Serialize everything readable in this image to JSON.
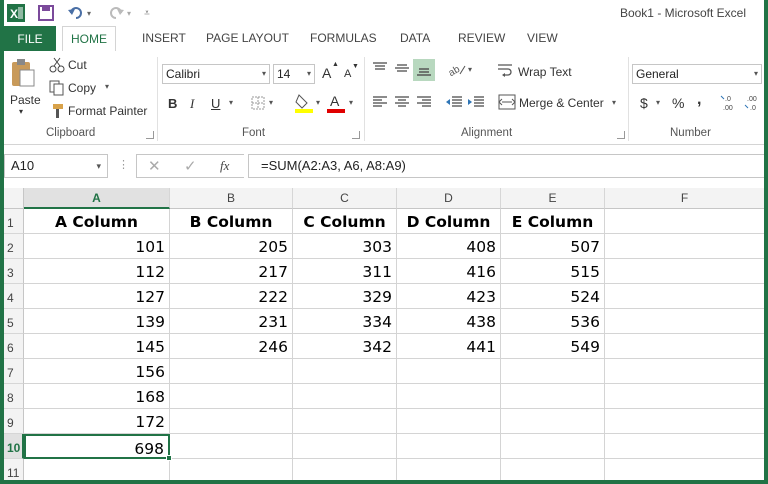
{
  "window": {
    "title": "Book1 - Microsoft Excel"
  },
  "ribbon_tabs": [
    "FILE",
    "HOME",
    "INSERT",
    "PAGE LAYOUT",
    "FORMULAS",
    "DATA",
    "REVIEW",
    "VIEW"
  ],
  "clipboard": {
    "paste": "Paste",
    "cut": "Cut",
    "copy": "Copy",
    "format_painter": "Format Painter",
    "group": "Clipboard"
  },
  "font": {
    "name": "Calibri",
    "size": "14",
    "group": "Font",
    "bold": "B",
    "italic": "I",
    "underline": "U",
    "grow": "A",
    "shrink": "A"
  },
  "alignment": {
    "wrap": "Wrap Text",
    "merge": "Merge & Center",
    "group": "Alignment"
  },
  "number": {
    "format": "General",
    "currency": "$",
    "percent": "%",
    "comma": ",",
    "group": "Number"
  },
  "formula_bar": {
    "name_box": "A10",
    "formula": "=SUM(A2:A3, A6, A8:A9)",
    "fx": "fx"
  },
  "sheet": {
    "columns": [
      "A",
      "B",
      "C",
      "D",
      "E",
      "F"
    ],
    "rows": [
      "1",
      "2",
      "3",
      "4",
      "5",
      "6",
      "7",
      "8",
      "9",
      "10",
      "11"
    ],
    "cells": [
      [
        "A Column",
        "B Column",
        "C Column",
        "D Column",
        "E Column",
        ""
      ],
      [
        "101",
        "205",
        "303",
        "408",
        "507",
        ""
      ],
      [
        "112",
        "217",
        "311",
        "416",
        "515",
        ""
      ],
      [
        "127",
        "222",
        "329",
        "423",
        "524",
        ""
      ],
      [
        "139",
        "231",
        "334",
        "438",
        "536",
        ""
      ],
      [
        "145",
        "246",
        "342",
        "441",
        "549",
        ""
      ],
      [
        "156",
        "",
        "",
        "",
        "",
        ""
      ],
      [
        "168",
        "",
        "",
        "",
        "",
        ""
      ],
      [
        "172",
        "",
        "",
        "",
        "",
        ""
      ],
      [
        "698",
        "",
        "",
        "",
        "",
        ""
      ],
      [
        "",
        "",
        "",
        "",
        "",
        ""
      ]
    ],
    "active_cell": "A10"
  },
  "colors": {
    "accent": "#217346",
    "font_color_bar": "#e00000",
    "highlight_bar": "#ffff00"
  }
}
